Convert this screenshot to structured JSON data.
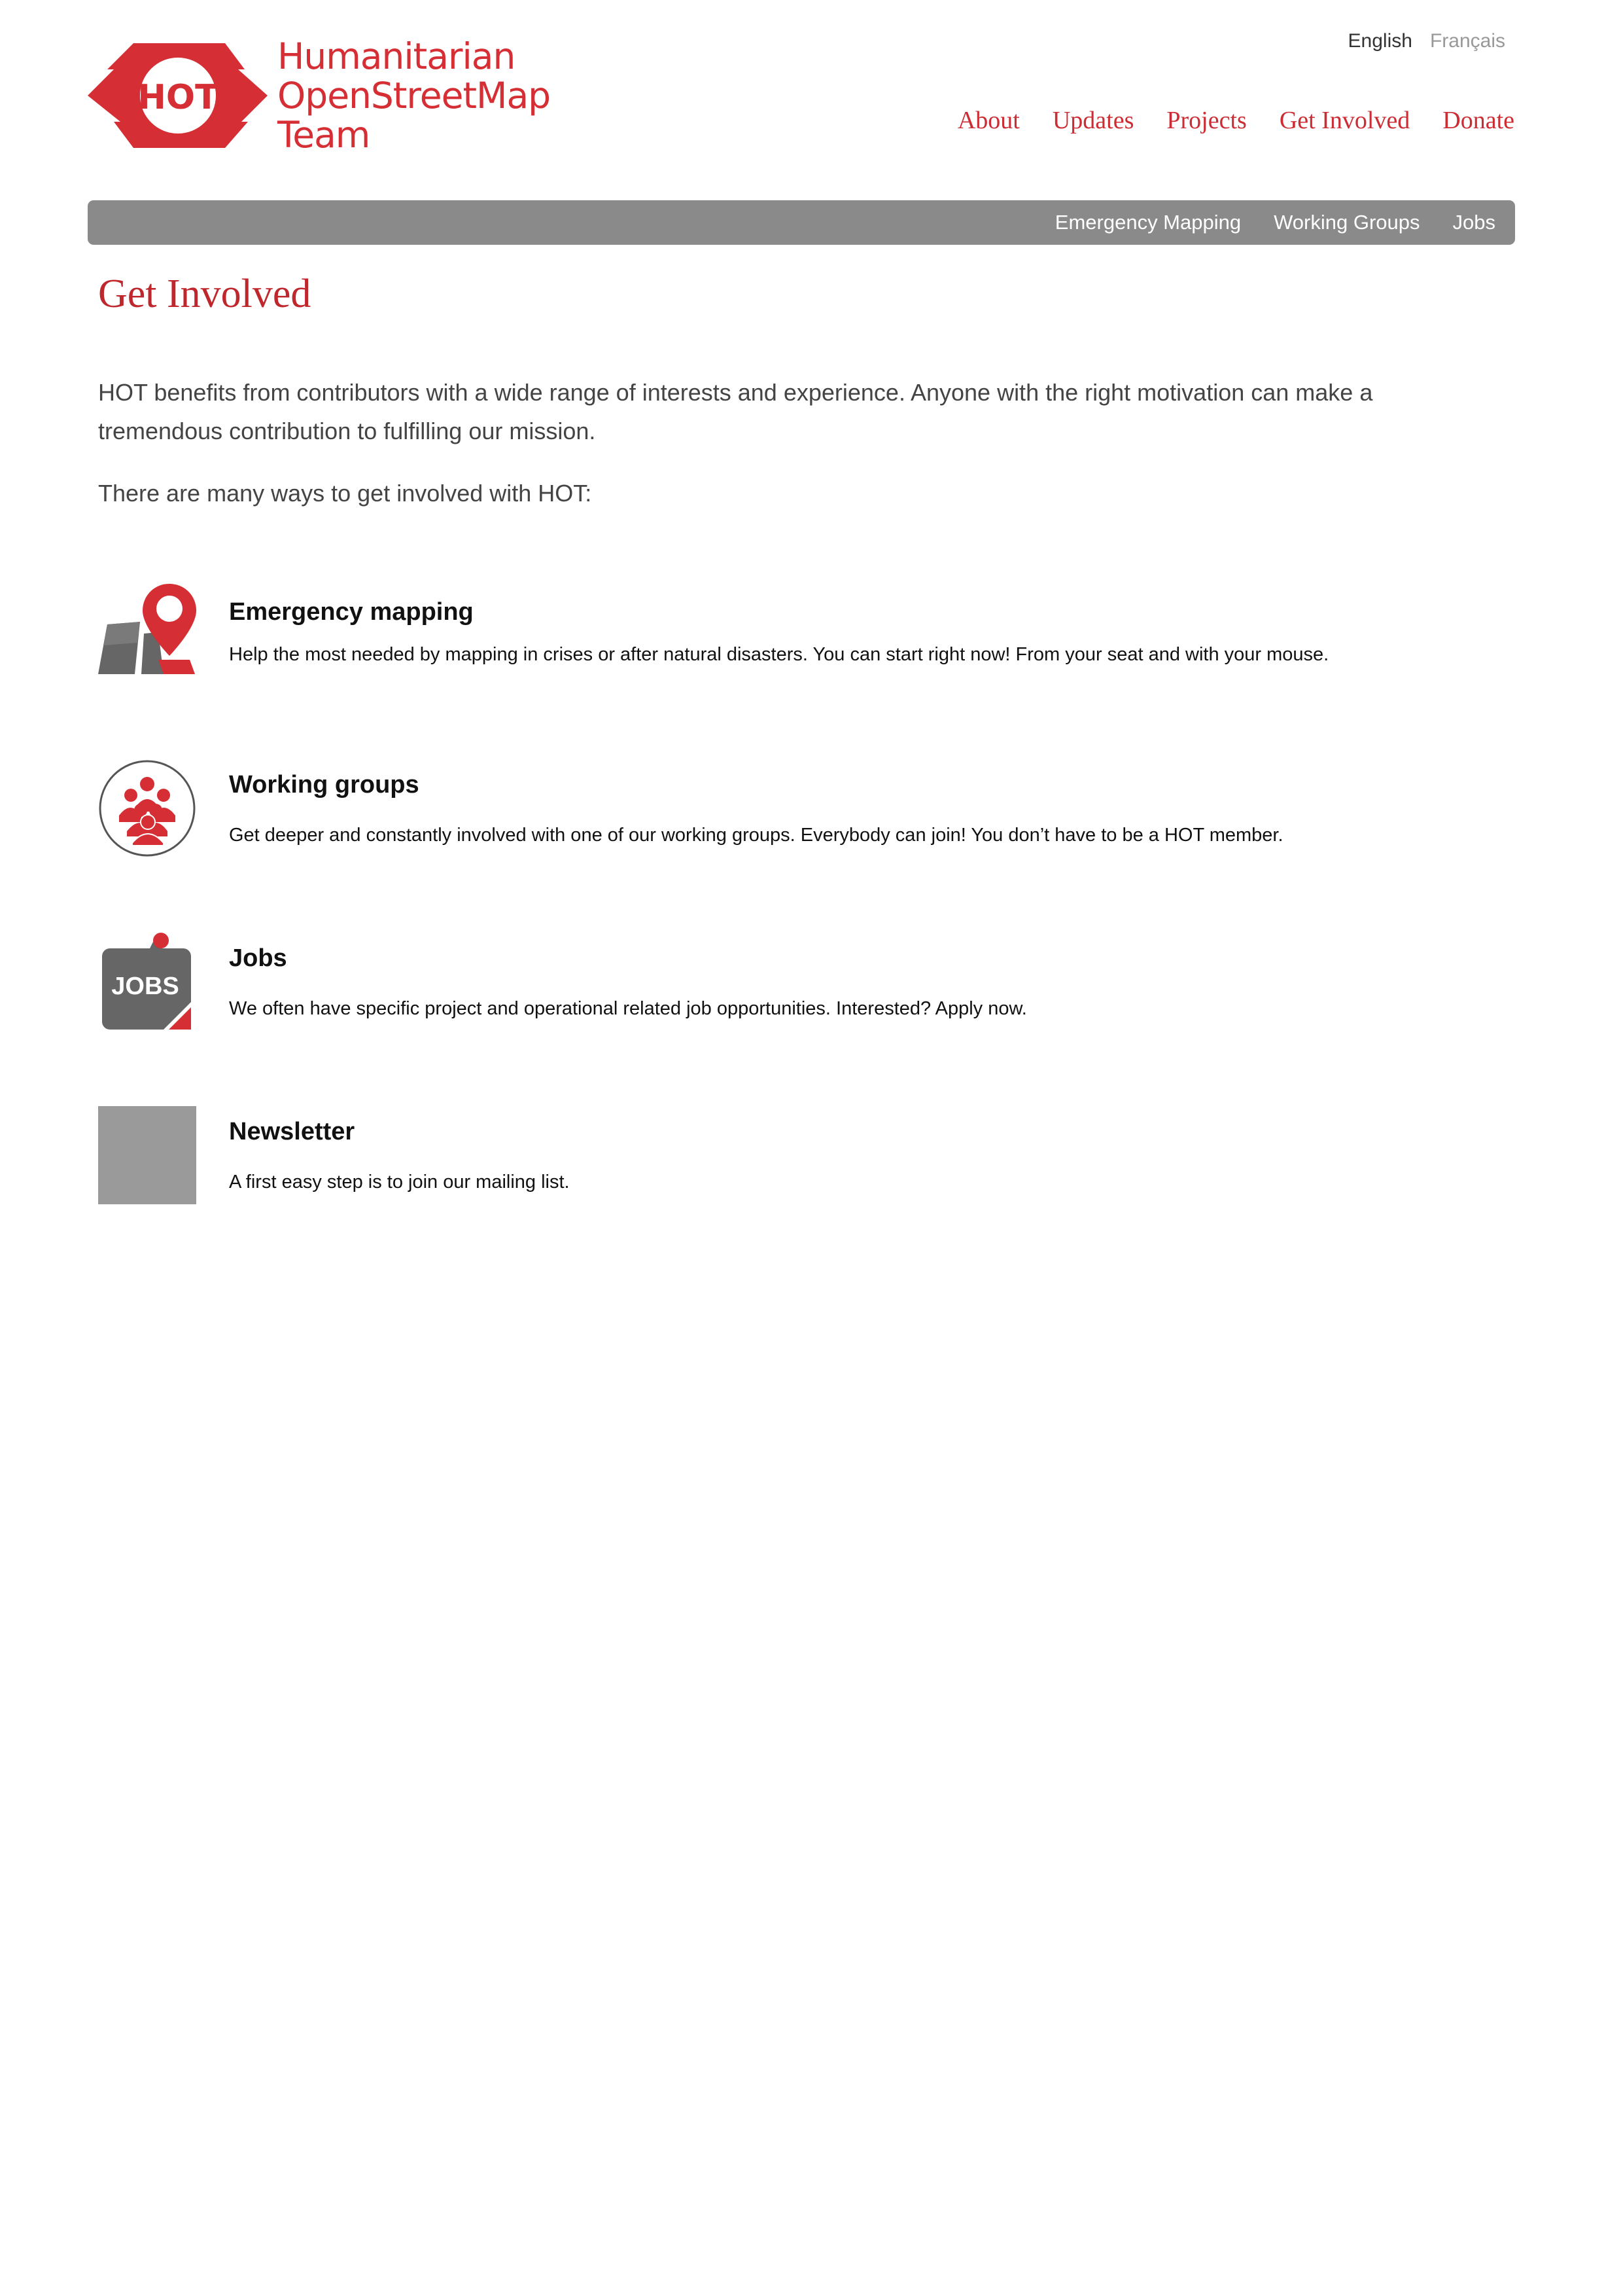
{
  "brand": {
    "logo_badge": "HOT",
    "logo_lines": [
      "Humanitarian",
      "OpenStreetMap",
      "Team"
    ],
    "accent_color": "#d52e34"
  },
  "languages": {
    "active": "English",
    "inactive": "Français"
  },
  "main_nav": [
    "About",
    "Updates",
    "Projects",
    "Get Involved",
    "Donate"
  ],
  "sub_nav": [
    "Emergency Mapping",
    "Working Groups",
    "Jobs"
  ],
  "page": {
    "title": "Get Involved",
    "intro": "HOT benefits from contributors with a wide range of interests and experience. Anyone with the right motivation can make a tremendous contribution to fulfilling our mission.",
    "ways": "There are many ways to get involved with HOT:"
  },
  "items": [
    {
      "title": "Emergency mapping",
      "text": "Help the most needed by mapping in crises or after natural disasters. You can start right now! From your seat and with your mouse.",
      "icon": "map-pin-icon"
    },
    {
      "title": "Working groups",
      "text": "Get deeper and constantly involved with one of our working groups. Everybody can join! You don’t have to be a HOT member.",
      "icon": "people-group-icon"
    },
    {
      "title": "Jobs",
      "text": "We often have specific project and operational related job opportunities. Interested? Apply now.",
      "icon": "jobs-icon",
      "icon_label": "JOBS"
    },
    {
      "title": "Newsletter",
      "text": "A first easy step is to join our mailing list.",
      "icon": "newsletter-placeholder-icon"
    }
  ]
}
